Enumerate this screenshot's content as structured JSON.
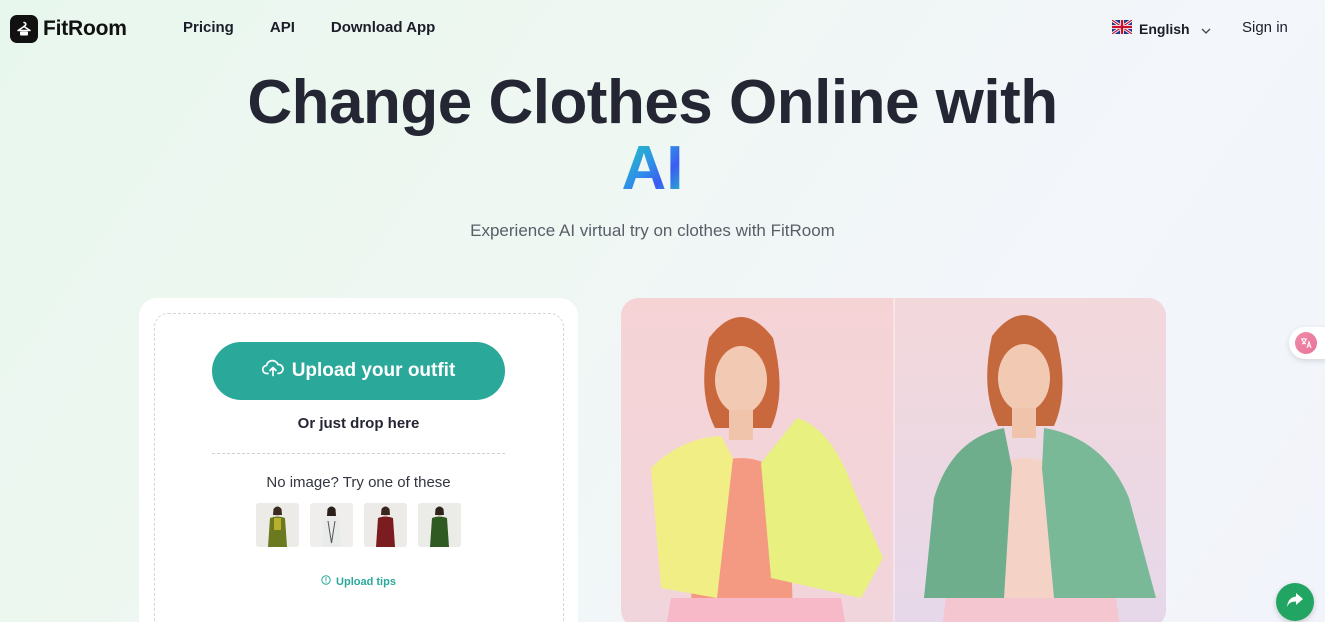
{
  "brand": {
    "name": "FitRoom"
  },
  "nav": {
    "items": [
      "Pricing",
      "API",
      "Download App"
    ]
  },
  "language": {
    "label": "English"
  },
  "auth": {
    "signin": "Sign in"
  },
  "hero": {
    "title": "Change Clothes Online with",
    "title_highlight": "AI",
    "subtitle": "Experience AI virtual try on clothes with FitRoom"
  },
  "upload": {
    "button_label": "Upload your outfit",
    "drop_text": "Or just drop here",
    "try_text": "No image? Try one of these",
    "tips_label": "Upload tips",
    "samples": [
      {
        "name": "olive outfit",
        "color": "#6b7a1e"
      },
      {
        "name": "white outfit",
        "color": "#e9ebea"
      },
      {
        "name": "burgundy outfit",
        "color": "#7a1c20"
      },
      {
        "name": "green outfit",
        "color": "#2f5a22"
      }
    ]
  },
  "colors": {
    "accent": "#2aa99a",
    "heading": "#252634",
    "fab": "#22a463"
  },
  "icons": {
    "logo": "hanger-box-icon",
    "language": "uk-flag-icon",
    "dropdown": "chevron-down-icon",
    "upload": "cloud-upload-icon",
    "tips": "info-circle-icon",
    "translate": "translate-icon",
    "share": "share-arrow-icon"
  }
}
